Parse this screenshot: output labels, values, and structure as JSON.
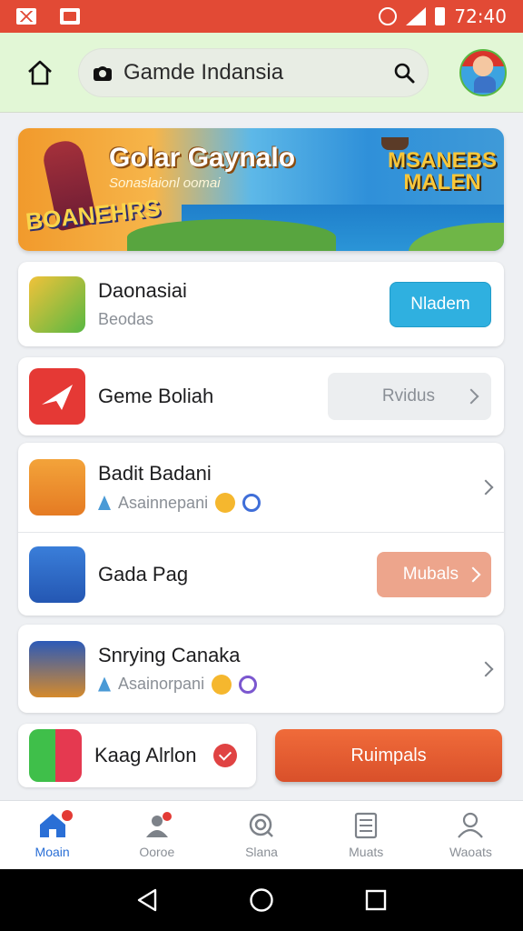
{
  "status_bar": {
    "time": "72:40",
    "left_icons": [
      "mail-icon",
      "image-icon"
    ],
    "right_icons": [
      "alarm-icon",
      "signal-icon",
      "battery-icon"
    ]
  },
  "header": {
    "search_text": "Gamde Indansia",
    "icons": [
      "home-icon",
      "camera-icon",
      "search-icon",
      "avatar"
    ]
  },
  "banner": {
    "title": "Golar Gaynalo",
    "subtitle": "Sonaslaionl oomai",
    "logo_left": "BOANEHRS",
    "logo_right": "MSANEBS MALEN"
  },
  "list": [
    {
      "title": "Daonasiai",
      "subtitle": "Beodas",
      "button": "Nladem"
    },
    {
      "title": "Geme Boliah",
      "button": "Rvidus"
    },
    {
      "title": "Badit Badani",
      "subtitle": "Asainnepani"
    },
    {
      "title": "Gada Pag",
      "button": "Mubals"
    },
    {
      "title": "Snrying Canaka",
      "subtitle": "Asainorpani"
    },
    {
      "title": "Kaag Alrlon",
      "button": "Ruimpals"
    }
  ],
  "colors": {
    "status_bar": "#e24a35",
    "header_bg": "#e2f7d6",
    "accent_blue": "#2fb0e0",
    "accent_orange": "#e35d30",
    "nav_active": "#2a6fd6"
  },
  "bottom_nav": [
    {
      "label": "Moain",
      "icon": "home-icon",
      "active": true
    },
    {
      "label": "Ooroe",
      "icon": "profile-icon"
    },
    {
      "label": "Slana",
      "icon": "search-icon"
    },
    {
      "label": "Muats",
      "icon": "list-icon"
    },
    {
      "label": "Waoats",
      "icon": "user-icon"
    }
  ]
}
